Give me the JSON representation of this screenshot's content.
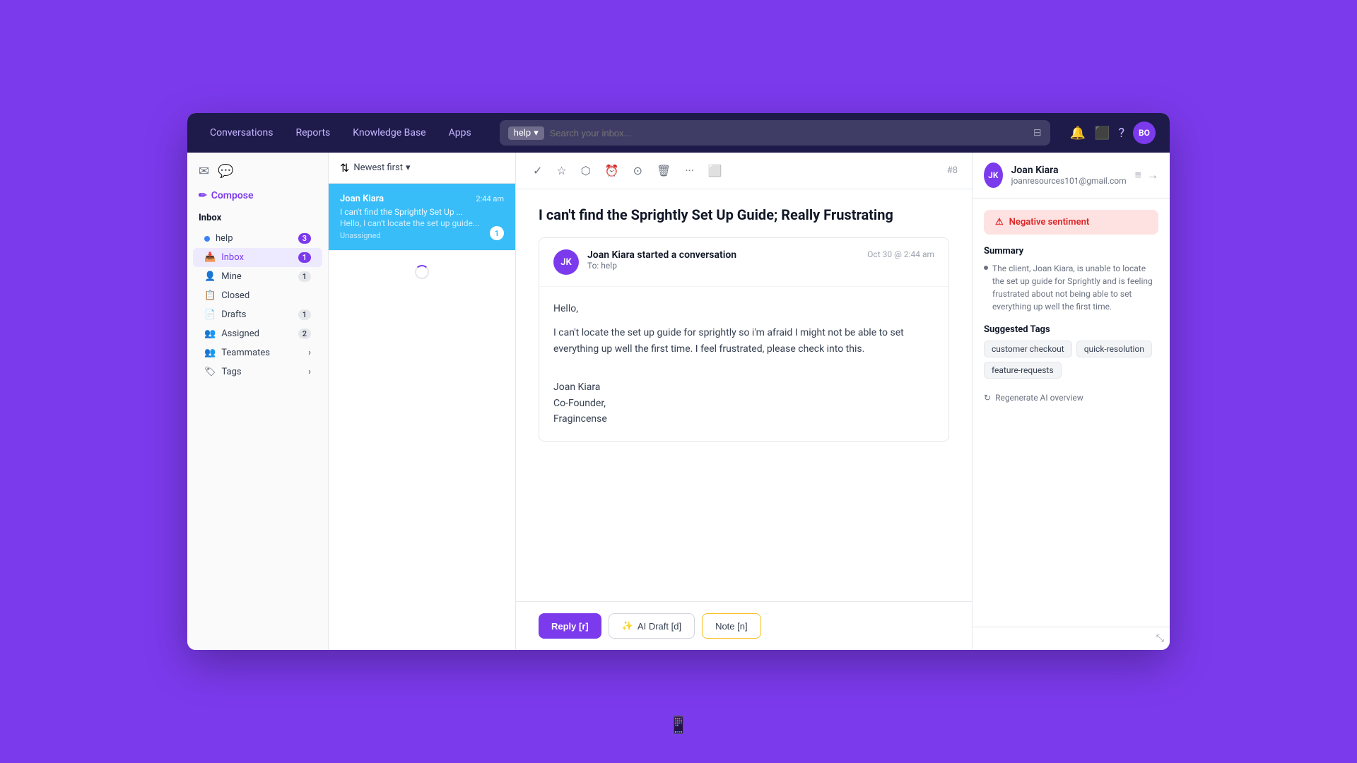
{
  "nav": {
    "items": [
      {
        "label": "Conversations",
        "active": false
      },
      {
        "label": "Reports",
        "active": false
      },
      {
        "label": "Knowledge Base",
        "active": false
      },
      {
        "label": "Apps",
        "active": false
      }
    ],
    "search_placeholder": "Search your inbox...",
    "help_label": "help",
    "avatar_label": "BO"
  },
  "sidebar": {
    "compose_label": "Compose",
    "inbox_title": "Inbox",
    "items": [
      {
        "label": "help",
        "badge": "3",
        "type": "dot",
        "dot_color": "blue"
      },
      {
        "label": "Inbox",
        "badge": "1",
        "active": true
      },
      {
        "label": "Mine",
        "badge": "1"
      },
      {
        "label": "Closed",
        "badge": ""
      },
      {
        "label": "Drafts",
        "badge": "1"
      },
      {
        "label": "Assigned",
        "badge": "2"
      },
      {
        "label": "Teammates",
        "has_arrow": true
      },
      {
        "label": "Tags",
        "has_arrow": true
      }
    ]
  },
  "conv_list": {
    "sort_label": "Newest first",
    "conversations": [
      {
        "sender": "Joan Kiara",
        "time": "2:44 am",
        "subject": "I can't find the Sprightly Set Up ...",
        "preview": "Hello, I can't locate the set up guide...",
        "badge": "1",
        "tag": "Unassigned",
        "active": true
      }
    ]
  },
  "conversation": {
    "number": "#8",
    "subject": "I can't find the Sprightly Set Up Guide; Really Frustrating",
    "message": {
      "sender": "Joan Kiara",
      "started_label": "Joan Kiara started a conversation",
      "to_label": "To: help",
      "date": "Oct 30 @ 2:44 am",
      "avatar_label": "JK",
      "greeting": "Hello,",
      "body": "I can't locate the set up guide for sprightly so i'm afraid I might not be able to set everything up well the first time. I feel frustrated, please check into this.",
      "sign_name": "Joan Kiara",
      "sign_title": "Co-Founder,",
      "sign_company": "Fragincense"
    },
    "buttons": {
      "reply": "Reply [r]",
      "ai_draft": "AI Draft [d]",
      "note": "Note [n]"
    }
  },
  "right_panel": {
    "contact": {
      "name": "Joan Kiara",
      "email": "joanresources101@gmail.com",
      "avatar_label": "JK"
    },
    "sentiment": {
      "label": "Negative sentiment",
      "icon": "⚠"
    },
    "summary_title": "Summary",
    "summary_text": "The client, Joan Kiara, is unable to locate the set up guide for Sprightly and is feeling frustrated about not being able to set everything up well the first time.",
    "suggested_tags_title": "Suggested Tags",
    "tags": [
      {
        "label": "customer checkout"
      },
      {
        "label": "quick-resolution"
      },
      {
        "label": "feature-requests"
      }
    ],
    "regen_label": "Regenerate AI overview"
  },
  "icons": {
    "check": "✓",
    "star": "☆",
    "tag": "⬡",
    "clock": "⏰",
    "timer": "⊙",
    "trash": "🗑",
    "more": "···",
    "screen": "⬜",
    "sort_arrow": "⇅",
    "compose_pen": "✏",
    "envelope": "✉",
    "chat": "💬",
    "refresh": "↺",
    "draft_icon": "✨",
    "chevron_down": "▾",
    "regen_icon": "↻",
    "grid_icon": "⊞",
    "close_icon": "→"
  }
}
